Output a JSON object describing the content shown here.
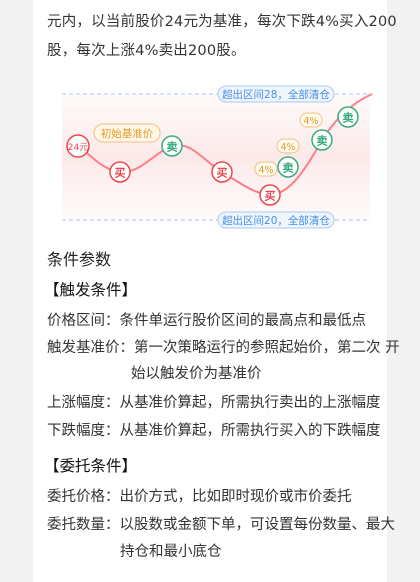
{
  "intro": {
    "line1": "元内，以当前股价24元为基准，每次下跌4%买入200",
    "line2": "股，每次上涨4%卖出200股。"
  },
  "diagram": {
    "top_label": "超出区间28，全部清仓",
    "bottom_label": "超出区间20，全部清仓",
    "start_value": "24元",
    "start_callout": "初始基准价",
    "buy": "买",
    "sell": "卖",
    "pct": "4%",
    "colors": {
      "line": "#ff7f8a",
      "buy": "#e8494d",
      "sell": "#3aab7e",
      "pct": "#f0a020",
      "band": "#4a8fe8"
    }
  },
  "params": {
    "title": "条件参数",
    "trigger": {
      "title": "【触发条件】",
      "range": "价格区间：条件单运行股价区间的最高点和最低点",
      "base_1": "触发基准价：第一次策略运行的参照起始价，第二次 开",
      "base_2": "始以触发价为基准价",
      "up": "上涨幅度：从基准价算起，所需执行卖出的上涨幅度",
      "down": "下跌幅度：从基准价算起，所需执行买入的下跌幅度"
    },
    "order": {
      "title": "【委托条件】",
      "price": "委托价格：出价方式，比如即时现价或市价委托",
      "qty_1": "委托数量：以股数或金额下单，可设置每份数量、最大",
      "qty_2": "持仓和最小底仓"
    }
  }
}
